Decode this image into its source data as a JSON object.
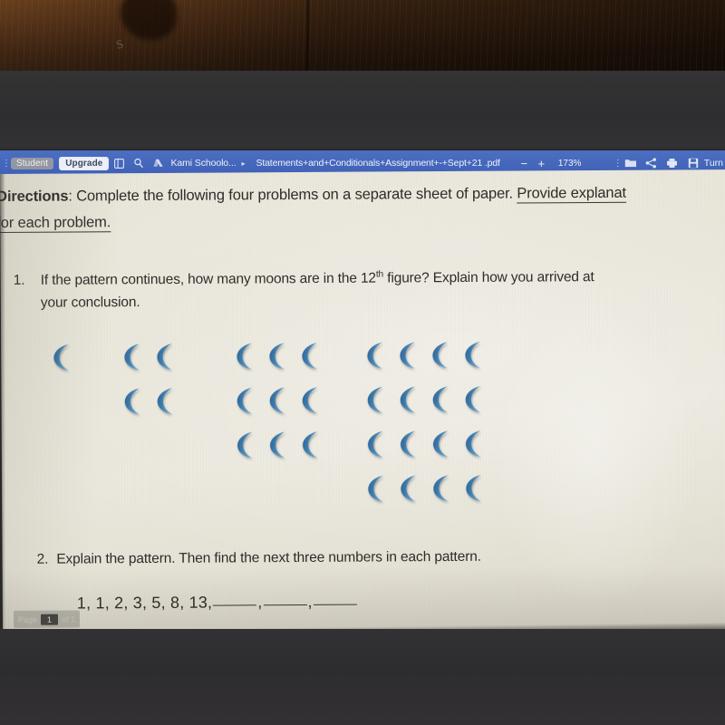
{
  "toolbar": {
    "menu_dots": "⋮",
    "student_badge": "Student",
    "upgrade_button": "Upgrade",
    "sidebar_icon_name": "sidebar-panel-icon",
    "search_icon_name": "search-icon",
    "drive_icon_name": "google-drive-icon",
    "account_name": "Kami Schoolo...",
    "breadcrumb_caret": "▸",
    "document_title": "Statements+and+Conditionals+Assignment+-+Sept+21 .pdf",
    "zoom_out": "−",
    "zoom_in": "+",
    "zoom_level": "173%",
    "overflow_dots": "⋮",
    "folder_icon_name": "folder-open-icon",
    "share_icon_name": "share-icon",
    "print_icon_name": "print-icon",
    "save_icon_name": "save-floppy-icon",
    "turn_in_label": "Turn"
  },
  "document": {
    "directions": {
      "lead": "Directions",
      "line1_normal": ": Complete the following four problems on a separate sheet of paper. ",
      "line1_underlined": "Provide explanat",
      "line2_underlined": "for each problem."
    },
    "question1": {
      "number": "1.",
      "line1_a": "If the pattern continues, how many moons are in the 12",
      "line1_sup": "th",
      "line1_b": " figure? Explain how you arrived at",
      "line2": "your conclusion."
    },
    "question2": {
      "number": "2.",
      "text": "Explain the pattern. Then find the next three numbers in each pattern.",
      "sequence": "1, 1, 2, 3, 5, 8, 13,"
    },
    "page_nav": {
      "label": "Page",
      "current": "1",
      "of": "of 1"
    }
  },
  "figure_data": {
    "type": "pattern",
    "description": "Growing square arrangement of crescent moon icons",
    "figures": [
      {
        "index": 1,
        "columns": 1,
        "rows": 1,
        "count": 1
      },
      {
        "index": 2,
        "columns": 2,
        "rows": 2,
        "count": 4
      },
      {
        "index": 3,
        "columns": 3,
        "rows": 3,
        "count": 9
      },
      {
        "index": 4,
        "columns": 4,
        "rows": 4,
        "count": 16
      }
    ],
    "rule": "n squared",
    "moon_color_dark": "#2f6496",
    "moon_color_light": "#5a9ccb"
  },
  "colors": {
    "toolbar_blue": "#4567bb",
    "page_cream": "#e8e5da",
    "screen_dark": "#2e2d2f",
    "desk_brown": "#5a3519",
    "text_dark": "#2d2c29"
  }
}
